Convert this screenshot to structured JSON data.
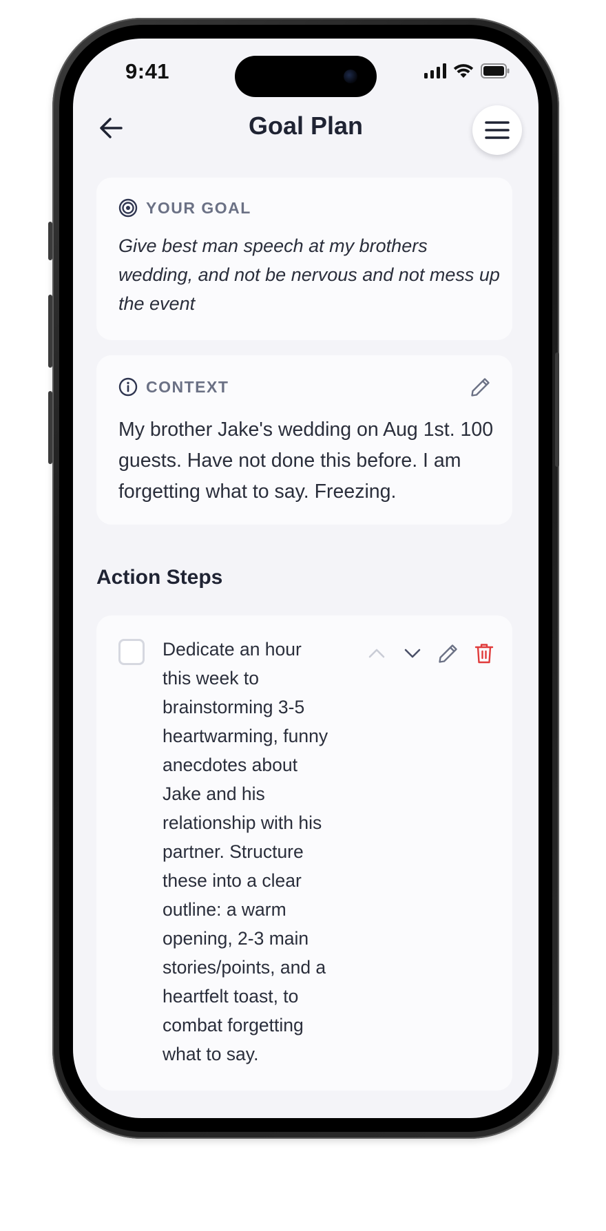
{
  "status_bar": {
    "time": "9:41"
  },
  "topbar": {
    "title": "Goal Plan",
    "back_icon": "arrow-left-icon",
    "menu_icon": "hamburger-menu-icon"
  },
  "goal_card": {
    "label": "YOUR GOAL",
    "icon": "target-icon",
    "text": "Give best man speech at my brothers wedding, and not be nervous and not mess up the event"
  },
  "context_card": {
    "label": "CONTEXT",
    "icon": "info-icon",
    "edit_icon": "pencil-icon",
    "text": "My brother Jake's wedding on Aug 1st. 100 guests. Have not done this before. I am forgetting what to say. Freezing."
  },
  "action_steps": {
    "title": "Action Steps",
    "steps": [
      {
        "text": "Dedicate an hour this week to brainstorming 3-5 heartwarming, funny anecdotes about Jake and his relationship with his partner. Structure these into a clear outline: a warm opening, 2-3 main stories/points, and a heartfelt toast, to combat forgetting what to say.",
        "checked": false
      }
    ]
  },
  "colors": {
    "background": "#f4f4f8",
    "card": "#fbfbfd",
    "label": "#6b7185",
    "text": "#2a2e3b",
    "danger": "#e03b3b"
  }
}
